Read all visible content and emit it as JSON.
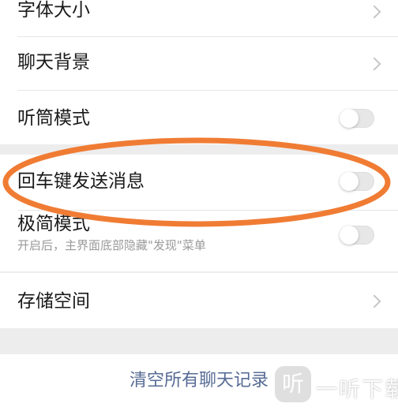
{
  "settings": {
    "font_size": {
      "label": "字体大小"
    },
    "chat_background": {
      "label": "聊天背景"
    },
    "earpiece_mode": {
      "label": "听筒模式",
      "enabled": false
    },
    "enter_to_send": {
      "label": "回车键发送消息",
      "enabled": false
    },
    "minimal_mode": {
      "label": "极简模式",
      "description": "开启后，主界面底部隐藏\"发现\"菜单",
      "enabled": false
    },
    "storage": {
      "label": "存储空间"
    },
    "clear_history": {
      "label": "清空所有聊天记录"
    }
  },
  "annotation": {
    "color": "#f07c34"
  },
  "watermark": {
    "icon_text": "听",
    "text": "一听下载"
  },
  "colors": {
    "link": "#576b95",
    "background": "#ededed"
  }
}
